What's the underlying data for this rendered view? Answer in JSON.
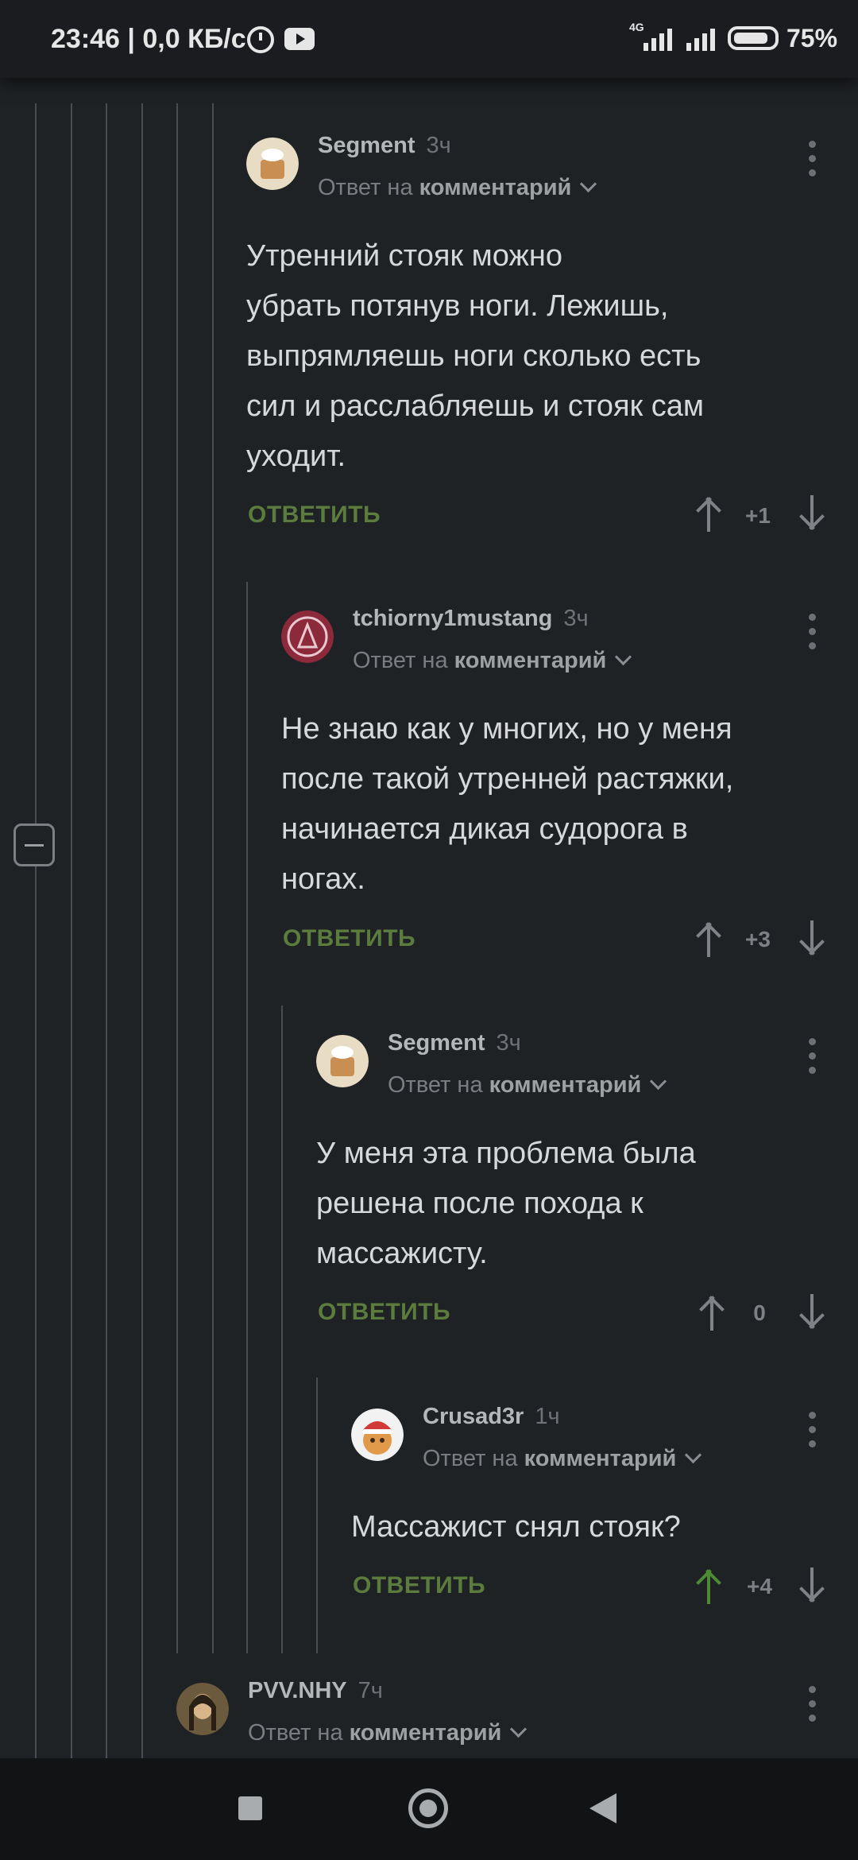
{
  "status_bar": {
    "time": "23:46 | 0,0 КБ/с",
    "network": "4G",
    "battery": "75%",
    "icons": [
      "alarm-icon",
      "youtube-icon",
      "signal-icon",
      "battery-icon"
    ]
  },
  "comments": [
    {
      "user": "Segment",
      "time": "3ч",
      "reply_prefix": "Ответ на",
      "reply_target": "комментарий",
      "text_lines": [
        "Утренний стояк можно",
        "убрать потянув ноги. Лежишь,",
        "выпрямляешь ноги сколько есть",
        "сил и расслабляешь и стояк сам",
        "уходит."
      ],
      "reply_label": "ОТВЕТИТЬ",
      "score": "+1"
    },
    {
      "user": "tchiorny1mustang",
      "time": "3ч",
      "reply_prefix": "Ответ на",
      "reply_target": "комментарий",
      "text_lines": [
        "Не знаю как у многих, но у меня",
        "после такой утренней растяжки,",
        "начинается дикая судорога в",
        "ногах."
      ],
      "reply_label": "ОТВЕТИТЬ",
      "score": "+3"
    },
    {
      "user": "Segment",
      "time": "3ч",
      "reply_prefix": "Ответ на",
      "reply_target": "комментарий",
      "text_lines": [
        "У меня эта проблема была",
        "решена после похода к",
        "массажисту."
      ],
      "reply_label": "ОТВЕТИТЬ",
      "score": "0"
    },
    {
      "user": "Crusad3r",
      "time": "1ч",
      "reply_prefix": "Ответ на",
      "reply_target": "комментарий",
      "text_lines": [
        "Массажист снял стояк?"
      ],
      "reply_label": "ОТВЕТИТЬ",
      "score": "+4"
    },
    {
      "user": "PVV.NHY",
      "time": "7ч",
      "reply_prefix": "Ответ на",
      "reply_target": "комментарий"
    }
  ],
  "colors": {
    "background": "#1f2225",
    "reply_green": "#5b7c3d",
    "upvoted_green": "#4e8a34"
  }
}
